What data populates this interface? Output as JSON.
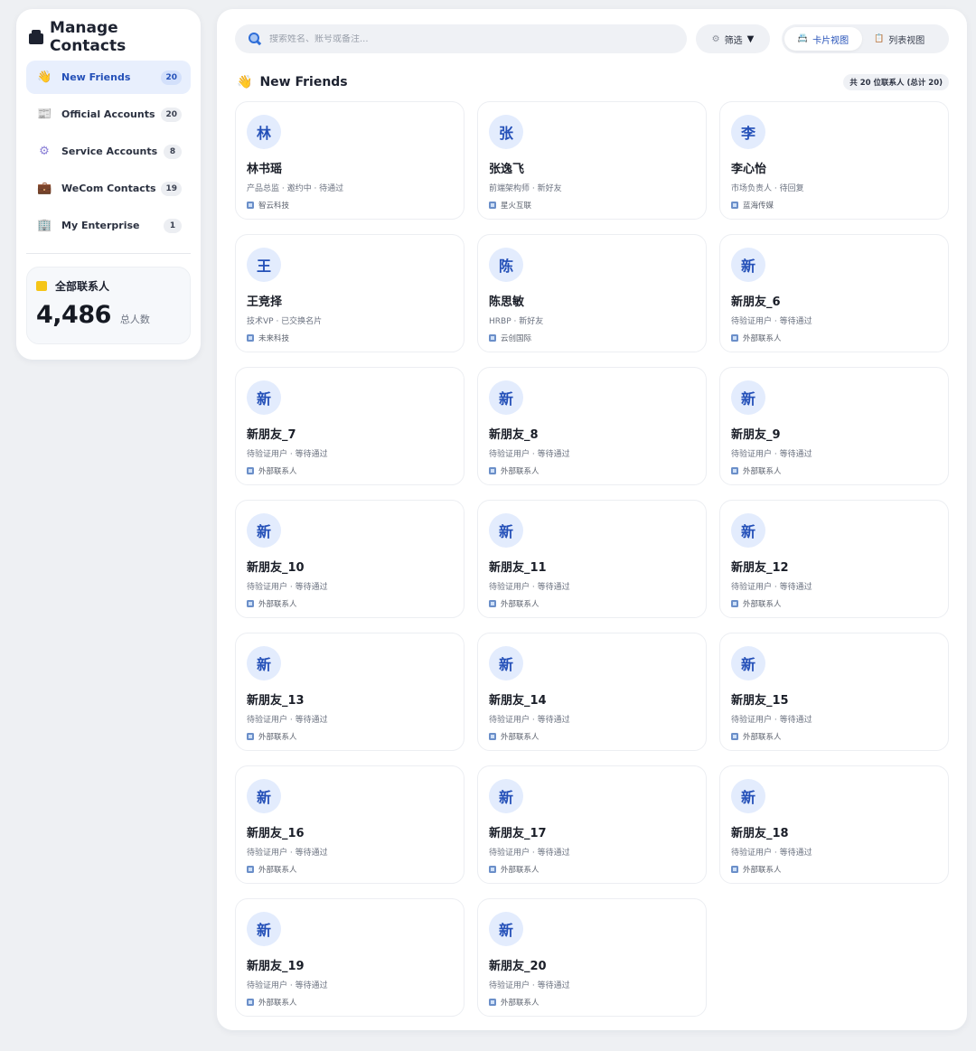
{
  "sidebar": {
    "title": "Manage Contacts",
    "items": [
      {
        "label": "New Friends",
        "count": "20",
        "icon": "👋",
        "icon_name": "waving-hand-icon",
        "active": true
      },
      {
        "label": "Official Accounts",
        "count": "20",
        "icon": "📰",
        "icon_name": "newspaper-icon"
      },
      {
        "label": "Service Accounts",
        "count": "8",
        "icon": "⚙",
        "icon_name": "gear-icon"
      },
      {
        "label": "WeCom Contacts",
        "count": "19",
        "icon": "💼",
        "icon_name": "briefcase-icon"
      },
      {
        "label": "My Enterprise",
        "count": "1",
        "icon": "🏢",
        "icon_name": "building-icon"
      }
    ],
    "total": {
      "label": "全部联系人",
      "value": "4,486",
      "unit": "总人数"
    }
  },
  "toolbar": {
    "search_placeholder": "搜索姓名、账号或备注...",
    "filter_label": "筛选",
    "filter_arrow": "▼",
    "view_card": "卡片视图",
    "view_list": "列表视图"
  },
  "section": {
    "title": "New Friends",
    "count_text": "共 20 位联系人 (总计 20)"
  },
  "contacts": [
    {
      "avatar": "林",
      "name": "林书瑶",
      "desc": "产品总监 · 邀约中 · 待通过",
      "org": "智云科技"
    },
    {
      "avatar": "张",
      "name": "张逸飞",
      "desc": "前端架构师 · 新好友",
      "org": "星火互联"
    },
    {
      "avatar": "李",
      "name": "李心怡",
      "desc": "市场负责人 · 待回复",
      "org": "蓝海传媒"
    },
    {
      "avatar": "王",
      "name": "王竞择",
      "desc": "技术VP · 已交换名片",
      "org": "未来科技"
    },
    {
      "avatar": "陈",
      "name": "陈思敏",
      "desc": "HRBP · 新好友",
      "org": "云创国际"
    },
    {
      "avatar": "新",
      "name": "新朋友_6",
      "desc": "待验证用户 · 等待通过",
      "org": "外部联系人"
    },
    {
      "avatar": "新",
      "name": "新朋友_7",
      "desc": "待验证用户 · 等待通过",
      "org": "外部联系人"
    },
    {
      "avatar": "新",
      "name": "新朋友_8",
      "desc": "待验证用户 · 等待通过",
      "org": "外部联系人"
    },
    {
      "avatar": "新",
      "name": "新朋友_9",
      "desc": "待验证用户 · 等待通过",
      "org": "外部联系人"
    },
    {
      "avatar": "新",
      "name": "新朋友_10",
      "desc": "待验证用户 · 等待通过",
      "org": "外部联系人"
    },
    {
      "avatar": "新",
      "name": "新朋友_11",
      "desc": "待验证用户 · 等待通过",
      "org": "外部联系人"
    },
    {
      "avatar": "新",
      "name": "新朋友_12",
      "desc": "待验证用户 · 等待通过",
      "org": "外部联系人"
    },
    {
      "avatar": "新",
      "name": "新朋友_13",
      "desc": "待验证用户 · 等待通过",
      "org": "外部联系人"
    },
    {
      "avatar": "新",
      "name": "新朋友_14",
      "desc": "待验证用户 · 等待通过",
      "org": "外部联系人"
    },
    {
      "avatar": "新",
      "name": "新朋友_15",
      "desc": "待验证用户 · 等待通过",
      "org": "外部联系人"
    },
    {
      "avatar": "新",
      "name": "新朋友_16",
      "desc": "待验证用户 · 等待通过",
      "org": "外部联系人"
    },
    {
      "avatar": "新",
      "name": "新朋友_17",
      "desc": "待验证用户 · 等待通过",
      "org": "外部联系人"
    },
    {
      "avatar": "新",
      "name": "新朋友_18",
      "desc": "待验证用户 · 等待通过",
      "org": "外部联系人"
    },
    {
      "avatar": "新",
      "name": "新朋友_19",
      "desc": "待验证用户 · 等待通过",
      "org": "外部联系人"
    },
    {
      "avatar": "新",
      "name": "新朋友_20",
      "desc": "待验证用户 · 等待通过",
      "org": "外部联系人"
    }
  ],
  "colors": {
    "accent": "#2450b8",
    "active_bg": "#e8effd",
    "avatar_bg": "#e3ecfd",
    "page_bg": "#eef0f3"
  }
}
